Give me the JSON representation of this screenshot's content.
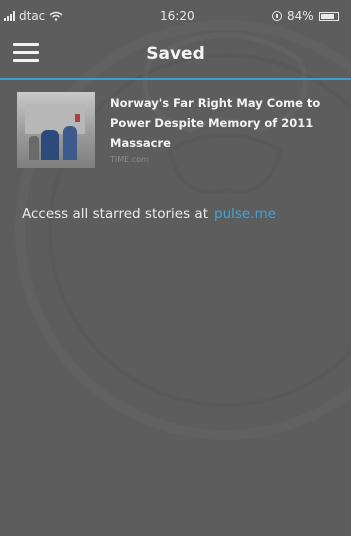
{
  "status_bar": {
    "carrier": "dtac",
    "time": "16:20",
    "battery": "84%",
    "battery_level": 0.84
  },
  "nav": {
    "title": "Saved",
    "menu_icon": "hamburger-menu-icon"
  },
  "stories": [
    {
      "title": "Norway's Far Right May Come to Power Despite Memory of 2011 Massacre",
      "source": "TIME.com"
    }
  ],
  "footer_note": {
    "text": "Access all starred stories at",
    "link": "pulse.me"
  },
  "colors": {
    "background": "#5d5d5d",
    "accent": "#3a9fd0"
  }
}
